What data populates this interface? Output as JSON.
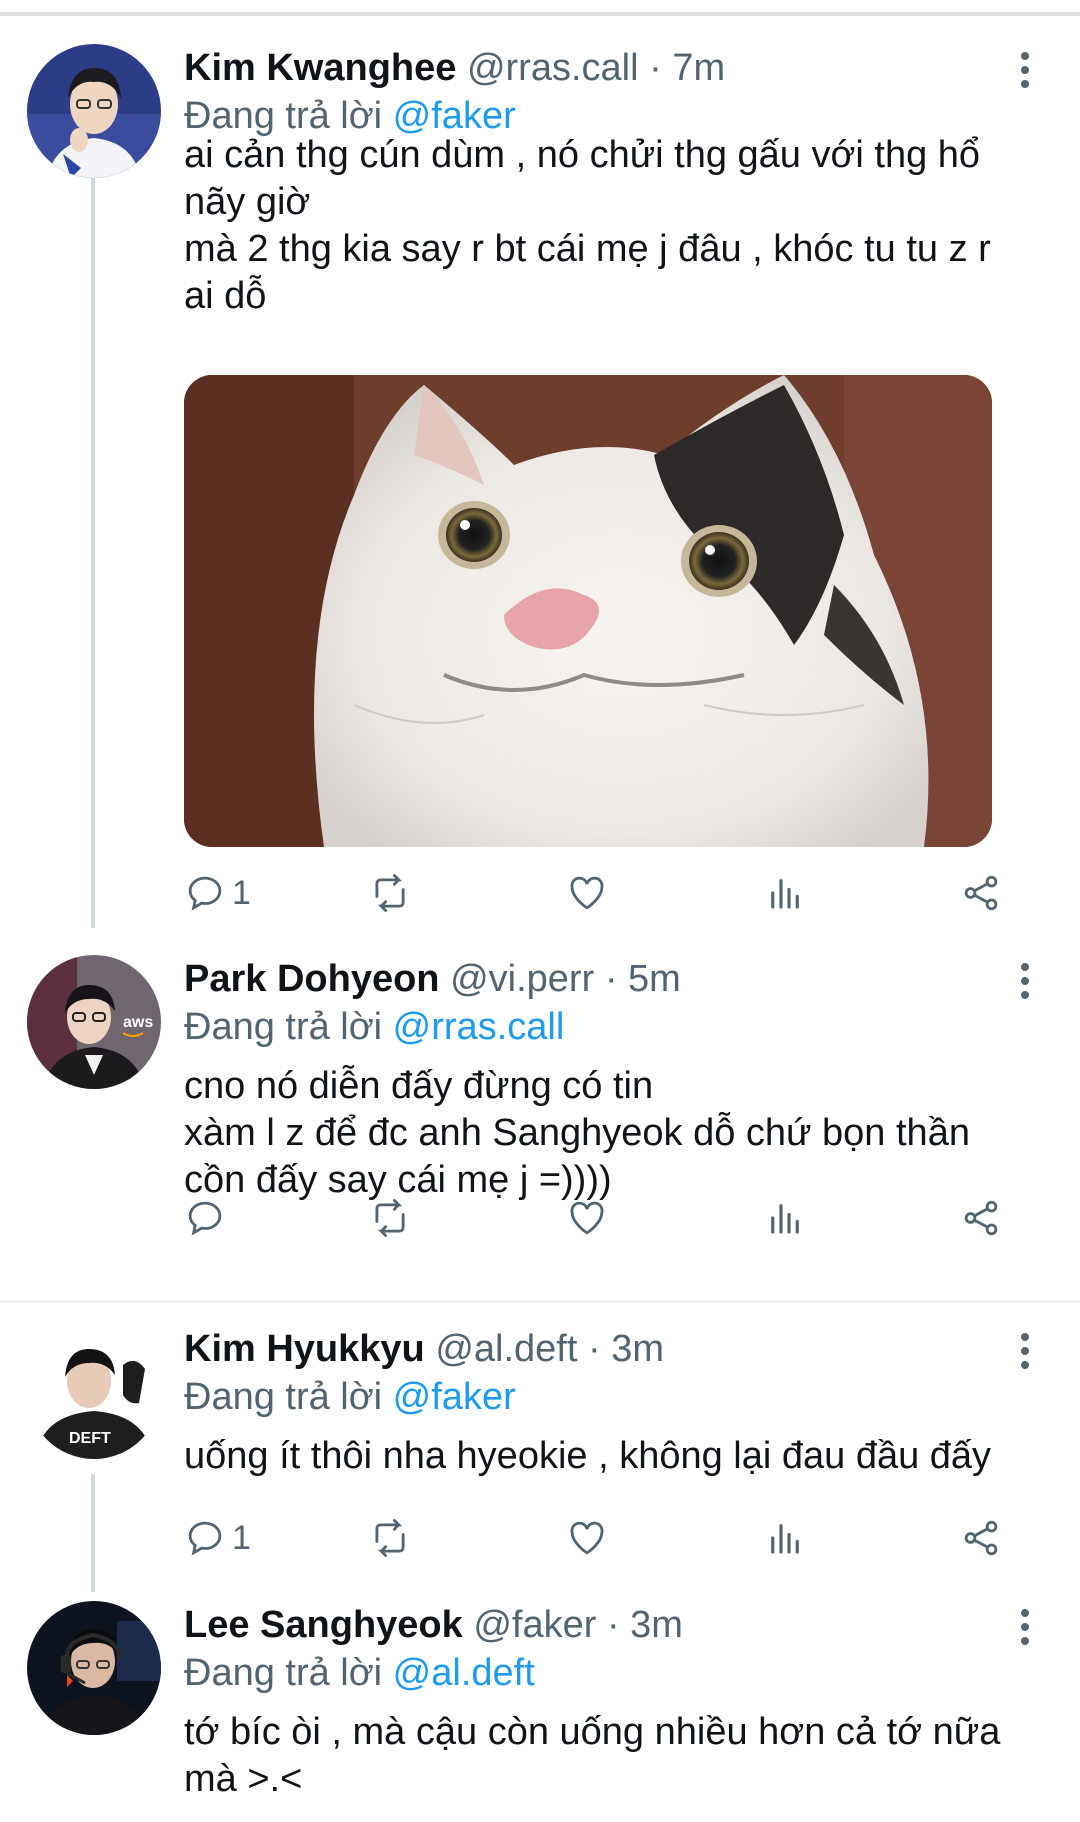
{
  "tweets": [
    {
      "name": "Kim Kwanghee",
      "handle": "@rras.call",
      "time": "7m",
      "replying_prefix": "Đang trả lời",
      "replying_to": "@faker",
      "lines": [
        "ai cản thg cún dùm , nó chửi thg gấu với thg hổ",
        "nãy giờ",
        "mà 2 thg kia say r bt cái mẹ j đâu , khóc tu tu z r",
        "ai dỗ"
      ],
      "has_image": true,
      "reply_count": "1",
      "retweet_count": "",
      "like_count": ""
    },
    {
      "name": "Park Dohyeon",
      "handle": "@vi.perr",
      "time": "5m",
      "replying_prefix": "Đang trả lời",
      "replying_to": "@rras.call",
      "lines": [
        "cno nó diễn đấy đừng có tin",
        "xàm l z để đc anh Sanghyeok dỗ chứ bọn thần",
        "cồn đấy say cái mẹ j =))))"
      ],
      "reply_count": "",
      "retweet_count": "",
      "like_count": ""
    },
    {
      "name": "Kim Hyukkyu",
      "handle": "@al.deft",
      "time": "3m",
      "replying_prefix": "Đang trả lời",
      "replying_to": "@faker",
      "lines": [
        "uống ít thôi nha hyeokie , không lại đau đầu đấy"
      ],
      "avatar_badge": "DEFT",
      "reply_count": "1",
      "retweet_count": "",
      "like_count": ""
    },
    {
      "name": "Lee Sanghyeok",
      "handle": "@faker",
      "time": "3m",
      "replying_prefix": "Đang trả lời",
      "replying_to": "@al.deft",
      "lines": [
        "tớ bíc òi , mà cậu còn uống nhiều hơn cả tớ nữa",
        "mà >.<"
      ]
    }
  ],
  "separator": "·",
  "avatar_badges": {
    "aws": "aws"
  },
  "icons": [
    "reply-icon",
    "retweet-icon",
    "like-icon",
    "analytics-icon",
    "share-icon",
    "more-icon"
  ],
  "colors": {
    "link": "#1d9bf0",
    "muted": "#536471",
    "text": "#0f1419",
    "thread_line": "#cfd9de"
  }
}
